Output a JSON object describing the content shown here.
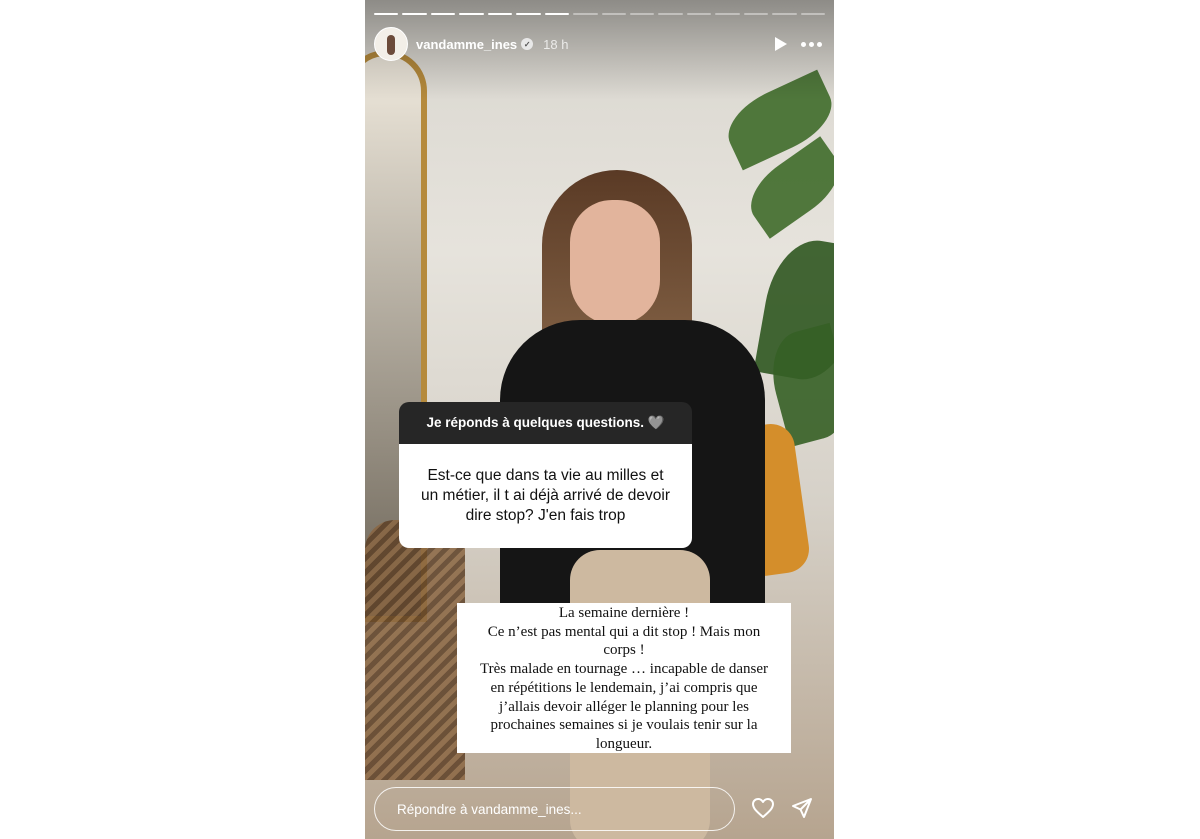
{
  "story": {
    "progress": {
      "total": 16,
      "viewed": 7
    },
    "header": {
      "username": "vandamme_ines",
      "verified_icon": "verified-badge-icon",
      "time": "18 h",
      "icons": [
        "play-icon",
        "more-icon"
      ]
    },
    "question": {
      "heading": "Je réponds à quelques questions. 🩶",
      "text": "Est-ce que dans ta vie au milles et un métier, il t ai déjà arrivé de devoir dire stop? J'en fais trop"
    },
    "answer": {
      "lines": [
        "La semaine dernière !",
        "Ce n’est pas mental qui a dit stop ! Mais mon",
        "corps  !",
        "Très malade en tournage … incapable de danser",
        "en répétitions le lendemain, j’ai compris que",
        "j’allais devoir alléger le planning pour les",
        "prochaines semaines si je voulais tenir sur la",
        "longueur."
      ]
    },
    "footer": {
      "reply_placeholder": "Répondre à vandamme_ines...",
      "icons": [
        "heart-icon",
        "send-icon"
      ]
    }
  }
}
